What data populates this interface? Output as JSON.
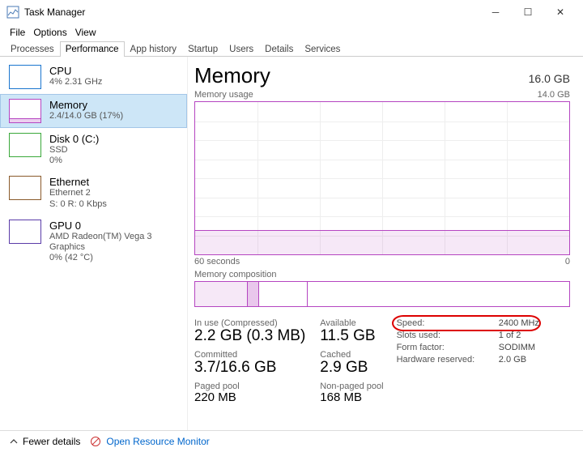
{
  "window": {
    "title": "Task Manager",
    "minimize": "─",
    "maximize": "☐",
    "close": "✕"
  },
  "menu": {
    "file": "File",
    "options": "Options",
    "view": "View"
  },
  "tabs": {
    "processes": "Processes",
    "performance": "Performance",
    "app_history": "App history",
    "startup": "Startup",
    "users": "Users",
    "details": "Details",
    "services": "Services"
  },
  "sidebar": {
    "cpu": {
      "title": "CPU",
      "sub": "4%  2.31 GHz"
    },
    "mem": {
      "title": "Memory",
      "sub": "2.4/14.0 GB (17%)"
    },
    "disk": {
      "title": "Disk 0 (C:)",
      "sub1": "SSD",
      "sub2": "0%"
    },
    "eth": {
      "title": "Ethernet",
      "sub1": "Ethernet 2",
      "sub2": "S: 0  R: 0 Kbps"
    },
    "gpu": {
      "title": "GPU 0",
      "sub1": "AMD Radeon(TM) Vega 3 Graphics",
      "sub2": "0%  (42 °C)"
    }
  },
  "main": {
    "title": "Memory",
    "total": "16.0 GB",
    "usage_label": "Memory usage",
    "usage_max": "14.0 GB",
    "xaxis_left": "60 seconds",
    "xaxis_right": "0",
    "comp_label": "Memory composition",
    "stats": {
      "in_use_label": "In use (Compressed)",
      "in_use": "2.2 GB (0.3 MB)",
      "available_label": "Available",
      "available": "11.5 GB",
      "committed_label": "Committed",
      "committed": "3.7/16.6 GB",
      "cached_label": "Cached",
      "cached": "2.9 GB",
      "paged_label": "Paged pool",
      "paged": "220 MB",
      "nonpaged_label": "Non-paged pool",
      "nonpaged": "168 MB"
    },
    "details": {
      "speed_label": "Speed:",
      "speed": "2400 MHz",
      "slots_label": "Slots used:",
      "slots": "1 of 2",
      "form_label": "Form factor:",
      "form": "SODIMM",
      "reserved_label": "Hardware reserved:",
      "reserved": "2.0 GB"
    }
  },
  "footer": {
    "fewer": "Fewer details",
    "orm": "Open Resource Monitor"
  }
}
